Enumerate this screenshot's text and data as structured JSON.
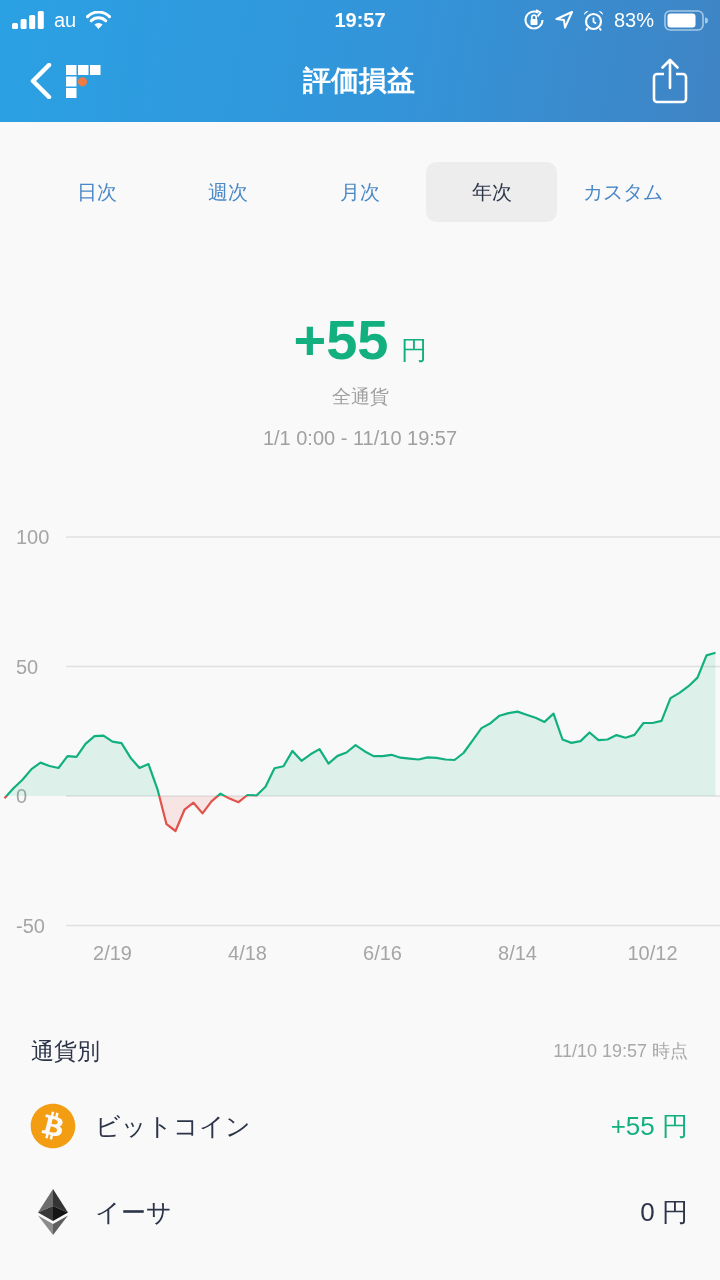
{
  "status_bar": {
    "carrier": "au",
    "time": "19:57",
    "battery": "83%"
  },
  "nav": {
    "title": "評価損益"
  },
  "tabs": [
    {
      "label": "日次",
      "selected": false
    },
    {
      "label": "週次",
      "selected": false
    },
    {
      "label": "月次",
      "selected": false
    },
    {
      "label": "年次",
      "selected": true
    },
    {
      "label": "カスタム",
      "selected": false
    }
  ],
  "summary": {
    "amount": "+55",
    "unit": "円",
    "gain": true,
    "scope": "全通貨",
    "period": "1/1 0:00 - 11/10 19:57"
  },
  "chart": {
    "chart_data": {
      "type": "area",
      "categories": [
        null,
        null,
        null,
        null,
        null,
        null,
        null,
        null,
        null,
        null,
        null,
        null,
        "2/19",
        null,
        null,
        null,
        null,
        null,
        null,
        null,
        null,
        null,
        null,
        null,
        null,
        null,
        null,
        "4/18",
        null,
        null,
        null,
        null,
        null,
        null,
        null,
        null,
        null,
        null,
        null,
        null,
        null,
        null,
        "6/16",
        null,
        null,
        null,
        null,
        null,
        null,
        null,
        null,
        null,
        null,
        null,
        null,
        null,
        null,
        "8/14",
        null,
        null,
        null,
        null,
        null,
        null,
        null,
        null,
        null,
        null,
        null,
        null,
        null,
        null,
        "10/12",
        null,
        null,
        null,
        null,
        null,
        null,
        null
      ],
      "series": [
        {
          "color": "#12b07f",
          "values": [
            -0.9,
            3,
            6.3,
            10.4,
            12.9,
            11.6,
            10.8,
            15.4,
            15.1,
            20.1,
            23.1,
            23.3,
            21,
            20.4,
            14.8,
            10.8,
            12.3,
            2.6,
            -10.9,
            -13.5,
            -5.3,
            -2.6,
            -6.7,
            -2.1,
            0.9,
            -1,
            -2.4,
            0.4,
            0.2,
            3.6,
            10.7,
            11.5,
            17.4,
            13.6,
            16.1,
            18.1,
            12.5,
            15.5,
            16.8,
            19.6,
            17.3,
            15.4,
            15.4,
            15.9,
            14.8,
            14.4,
            14.1,
            14.9,
            14.7,
            14.1,
            13.9,
            16.6,
            21.4,
            26.2,
            28.1,
            31,
            32,
            32.6,
            31.4,
            30.2,
            28.6,
            31.8,
            21.8,
            20.5,
            21.2,
            24.5,
            21.6,
            21.8,
            23.5,
            22.5,
            23.6,
            28.2,
            28.2,
            29,
            37.8,
            39.8,
            42.4,
            45.7,
            54.3,
            55.3
          ]
        }
      ],
      "ylim": [
        -50,
        100
      ],
      "yticks": [
        100,
        50,
        0,
        -50
      ]
    }
  },
  "currencies": {
    "title": "通貨別",
    "timestamp": "11/10 19:57 時点",
    "items": [
      {
        "name": "ビットコイン",
        "value": "+55 円",
        "gain": true
      },
      {
        "name": "イーサ",
        "value": "0 円",
        "gain": false
      }
    ]
  }
}
